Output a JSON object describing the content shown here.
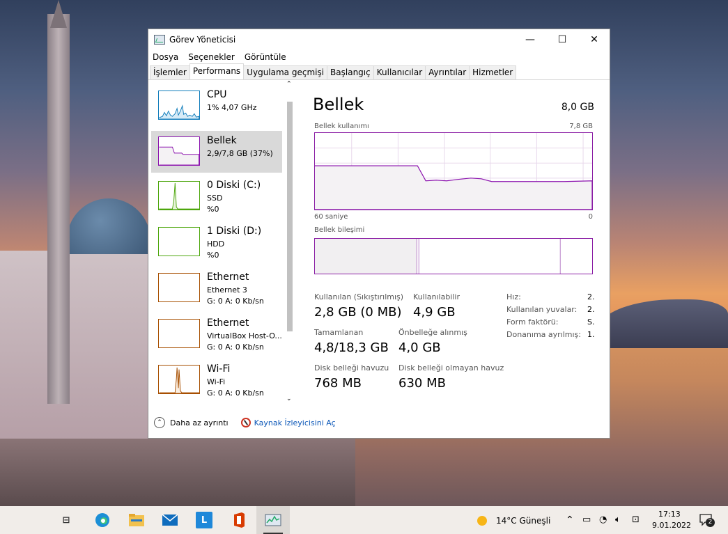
{
  "window": {
    "title": "Görev Yöneticisi",
    "minimize": "—",
    "maximize": "☐",
    "close": "✕"
  },
  "menu": [
    "Dosya",
    "Seçenekler",
    "Görüntüle"
  ],
  "tabs": [
    "İşlemler",
    "Performans",
    "Uygulama geçmişi",
    "Başlangıç",
    "Kullanıcılar",
    "Ayrıntılar",
    "Hizmetler"
  ],
  "resources": [
    {
      "name": "CPU",
      "line1": "1% 4,07 GHz",
      "line2": "",
      "color": "#117dbb"
    },
    {
      "name": "Bellek",
      "line1": "2,9/7,8 GB (37%)",
      "line2": "",
      "color": "#8b12ae"
    },
    {
      "name": "0 Diski (C:)",
      "line1": "SSD",
      "line2": "%0",
      "color": "#4da60c"
    },
    {
      "name": "1 Diski (D:)",
      "line1": "HDD",
      "line2": "%0",
      "color": "#4da60c"
    },
    {
      "name": "Ethernet",
      "line1": "Ethernet 3",
      "line2": "G: 0 A: 0 Kb/sn",
      "color": "#a74f01"
    },
    {
      "name": "Ethernet",
      "line1": "VirtualBox Host-O...",
      "line2": "G: 0 A: 0 Kb/sn",
      "color": "#a74f01"
    },
    {
      "name": "Wi-Fi",
      "line1": "Wi-Fi",
      "line2": "G: 0 A: 0 Kb/sn",
      "color": "#a74f01"
    }
  ],
  "detail": {
    "title": "Bellek",
    "total": "8,0 GB",
    "usage_label": "Bellek kullanımı",
    "usage_max": "7,8 GB",
    "time_left": "60 saniye",
    "time_right": "0",
    "composition_label": "Bellek bileşimi",
    "stats": {
      "in_use_label": "Kullanılan (Sıkıştırılmış)",
      "in_use_value": "2,8 GB (0 MB)",
      "available_label": "Kullanılabilir",
      "available_value": "4,9 GB",
      "committed_label": "Tamamlanan",
      "committed_value": "4,8/18,3 GB",
      "cached_label": "Önbelleğe alınmış",
      "cached_value": "4,0 GB",
      "paged_label": "Disk belleği havuzu",
      "paged_value": "768 MB",
      "nonpaged_label": "Disk belleği olmayan havuz",
      "nonpaged_value": "630 MB"
    },
    "props": [
      {
        "label": "Hız:",
        "value": "2."
      },
      {
        "label": "Kullanılan yuvalar:",
        "value": "2."
      },
      {
        "label": "Form faktörü:",
        "value": "S."
      },
      {
        "label": "Donanıma ayrılmış:",
        "value": "1."
      }
    ]
  },
  "footer": {
    "fewer_details": "Daha az ayrıntı",
    "resource_monitor": "Kaynak İzleyicisini Aç"
  },
  "taskbar": {
    "weather": "14°C  Güneşli",
    "time": "17:13",
    "date": "9.01.2022",
    "notifications": "2"
  }
}
